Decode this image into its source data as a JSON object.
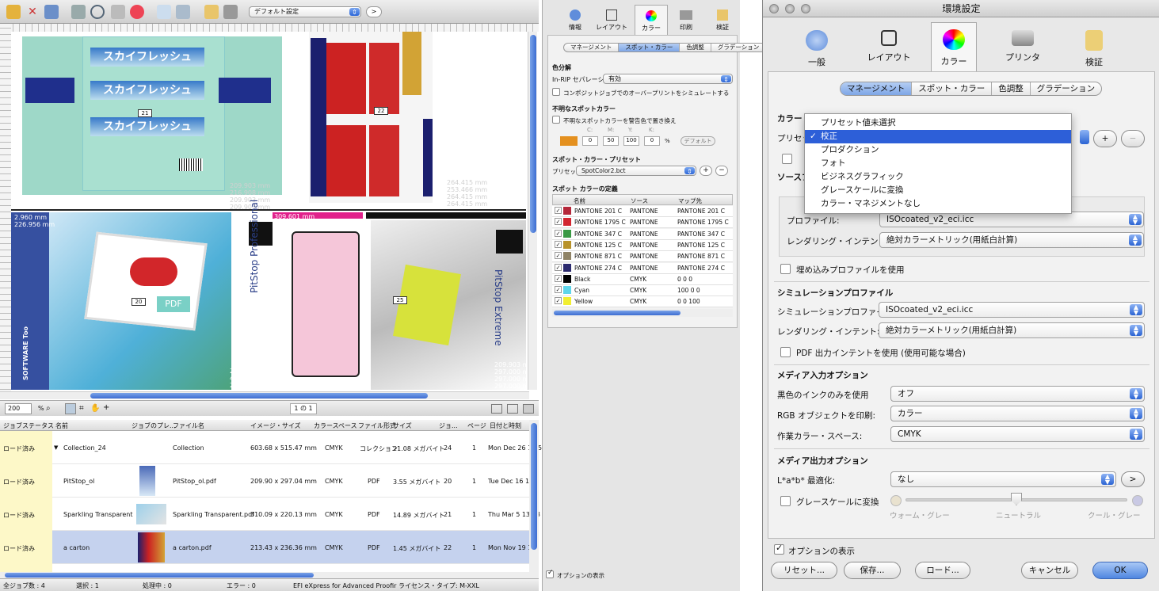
{
  "left": {
    "toolbar": {
      "preset_label": "デフォルト設定"
    },
    "zoom": {
      "value": "200",
      "unit": "%",
      "page": "1 の 1"
    },
    "tiles": {
      "tile21": "21",
      "tile22": "22",
      "tile20": "20",
      "tile25": "25",
      "pitstop_pro": "PitStop Professional",
      "pitstop_ext": "PitStop Extreme",
      "skyfresh": "スカイフレッシュ",
      "software_too": "SOFTWARE Too",
      "pdf": "PDF"
    },
    "measures": {
      "m1": "209.903 mm\n216.908 mm\n209.903 mm\n209.903 mm",
      "m2": "264.415 mm\n253.466 mm\n264.415 mm\n264.415 mm",
      "m3": "2.960 mm\n226.956 mm",
      "m4": "309.601 mm",
      "m5": "299.999 mm\n437.998 mm\n299.999 mm\n209.903 mm",
      "m6": "209.903 mm\n297.000 mm\n297.000 mm\n297.000 mm"
    },
    "table": {
      "headers": [
        "ジョブステータス",
        "名前",
        "ジョブのプレ...",
        "ファイル名",
        "イメージ・サイズ",
        "カラースペース",
        "ファイル形式",
        "サイズ",
        "ジョ...",
        "ページ",
        "日付と時刻"
      ],
      "rows": [
        {
          "status": "ロード済み",
          "name": "Collection_24",
          "file": "Collection",
          "size": "603.68 x 515.47 mm",
          "cs": "CMYK",
          "fmt": "コレクション",
          "bytes": "21.08 メガバイト",
          "job": "24",
          "pages": "1",
          "date": "Mon Dec 26 16:5"
        },
        {
          "status": "ロード済み",
          "name": "PitStop_ol",
          "file": "PitStop_ol.pdf",
          "size": "209.90 x 297.04 mm",
          "cs": "CMYK",
          "fmt": "PDF",
          "bytes": "3.55 メガバイト",
          "job": "20",
          "pages": "1",
          "date": "Tue Dec 16 10:"
        },
        {
          "status": "ロード済み",
          "name": "Sparkling Transparent",
          "file": "Sparkling Transparent.pdf",
          "size": "310.09 x 220.13 mm",
          "cs": "CMYK",
          "fmt": "PDF",
          "bytes": "14.89 メガバイト",
          "job": "21",
          "pages": "1",
          "date": "Thu Mar 5 13:18"
        },
        {
          "status": "ロード済み",
          "name": "a carton",
          "file": "a carton.pdf",
          "size": "213.43 x 236.36 mm",
          "cs": "CMYK",
          "fmt": "PDF",
          "bytes": "1.45 メガバイト",
          "job": "22",
          "pages": "1",
          "date": "Mon Nov 19 10:"
        }
      ]
    },
    "status": {
      "jobs": "全ジョブ数 : 4",
      "selected": "選択 : 1",
      "processing": "処理中 : 0",
      "errors": "エラー : 0",
      "product": "EFI eXpress for Advanced Proofir ライセンス・タイプ: M-XXL"
    }
  },
  "mid": {
    "tabs": {
      "info": "情報",
      "layout": "レイアウト",
      "color": "カラー",
      "print": "印刷",
      "verify": "検証"
    },
    "segments": [
      "マネージメント",
      "スポット・カラー",
      "色調整",
      "グラデーション"
    ],
    "active_segment": "スポット・カラー",
    "sep_title": "色分解",
    "sep_label": "In-RIP セパレーション",
    "sep_value": "有効",
    "overprint": "コンポジットジョブでのオーバープリントをシミュレートする",
    "unknown_title": "不明なスポットカラー",
    "unknown_chk": "不明なスポットカラーを警告色で置き換え",
    "cmyk_labels": [
      "C:",
      "M:",
      "Y:",
      "K:"
    ],
    "cmyk_values": [
      "0",
      "50",
      "100",
      "0"
    ],
    "pct": "%",
    "default_btn": "デフォルト",
    "spot_preset_title": "スポット・カラー・プリセット",
    "preset_label": "プリセット :",
    "preset_value": "SpotColor2.bct",
    "def_title": "スポット カラーの定義",
    "cols": [
      "名前",
      "ソース",
      "マップ先"
    ],
    "spots": [
      {
        "name": "PANTONE 201 C",
        "src": "PANTONE",
        "map": "PANTONE 201 C",
        "color": "#b5283a"
      },
      {
        "name": "PANTONE 1795 C",
        "src": "PANTONE",
        "map": "PANTONE 1795 C",
        "color": "#d22630"
      },
      {
        "name": "PANTONE 347 C",
        "src": "PANTONE",
        "map": "PANTONE 347 C",
        "color": "#3a9a45"
      },
      {
        "name": "PANTONE 125 C",
        "src": "PANTONE",
        "map": "PANTONE 125 C",
        "color": "#b8922a"
      },
      {
        "name": "PANTONE 871 C",
        "src": "PANTONE",
        "map": "PANTONE 871 C",
        "color": "#8f8366"
      },
      {
        "name": "PANTONE 274 C",
        "src": "PANTONE",
        "map": "PANTONE 274 C",
        "color": "#2b2a6e"
      },
      {
        "name": "Black",
        "src": "CMYK",
        "map": "0    0    0",
        "color": "#000000"
      },
      {
        "name": "Cyan",
        "src": "CMYK",
        "map": "100  0    0",
        "color": "#5fd5ea"
      },
      {
        "name": "Yellow",
        "src": "CMYK",
        "map": "0    0    100",
        "color": "#f1ee31"
      }
    ],
    "show_options": "オプションの表示"
  },
  "win": {
    "title": "環境設定",
    "tabs": {
      "general": "一般",
      "layout": "レイアウト",
      "color": "カラー",
      "printer": "プリンタ",
      "verify": "検証"
    },
    "segments": [
      "マネージメント",
      "スポット・カラー",
      "色調整",
      "グラデーション"
    ],
    "active_segment": "マネージメント",
    "color_head": "カラー・マ",
    "preset_label": "プリセット",
    "plus": "+",
    "minus": "−",
    "source_head": "ソースプ",
    "profile_label": "プロファイル:",
    "profile_value": "ISOcoated_v2_eci.icc",
    "intent_label": "レンダリング・インテント:",
    "intent_value": "絶対カラーメトリック(用紙白計算)",
    "embed": "埋め込みプロファイルを使用",
    "sim_head": "シミュレーションプロファイル",
    "sim_label": "シミュレーションプロファイル:",
    "sim_value": "ISOcoated_v2_eci.icc",
    "sim_intent_label": "レンダリング・インテント:",
    "sim_intent_value": "絶対カラーメトリック(用紙白計算)",
    "pdf_intent": "PDF 出力インテントを使用 (使用可能な場合)",
    "media_in_head": "メディア入力オプション",
    "black_label": "黒色のインクのみを使用",
    "black_value": "オフ",
    "rgb_label": "RGB オブジェクトを印刷:",
    "rgb_value": "カラー",
    "work_label": "作業カラー・スペース:",
    "work_value": "CMYK",
    "media_out_head": "メディア出力オプション",
    "lab_label": "L*a*b* 最適化:",
    "lab_value": "なし",
    "gray": "グレースケールに変換",
    "slider": {
      "left": "ウォーム・グレー",
      "mid": "ニュートラル",
      "right": "クール・グレー",
      "position": 0.5
    },
    "show_options": "オプションの表示",
    "buttons": {
      "reset": "リセット...",
      "save": "保存...",
      "load": "ロード...",
      "cancel": "キャンセル",
      "ok": "OK"
    },
    "menu": [
      "プリセット値未選択",
      "校正",
      "プロダクション",
      "フォト",
      "ビジネスグラフィック",
      "グレースケールに変換",
      "カラー・マネジメントなし"
    ],
    "menu_selected": "校正"
  }
}
